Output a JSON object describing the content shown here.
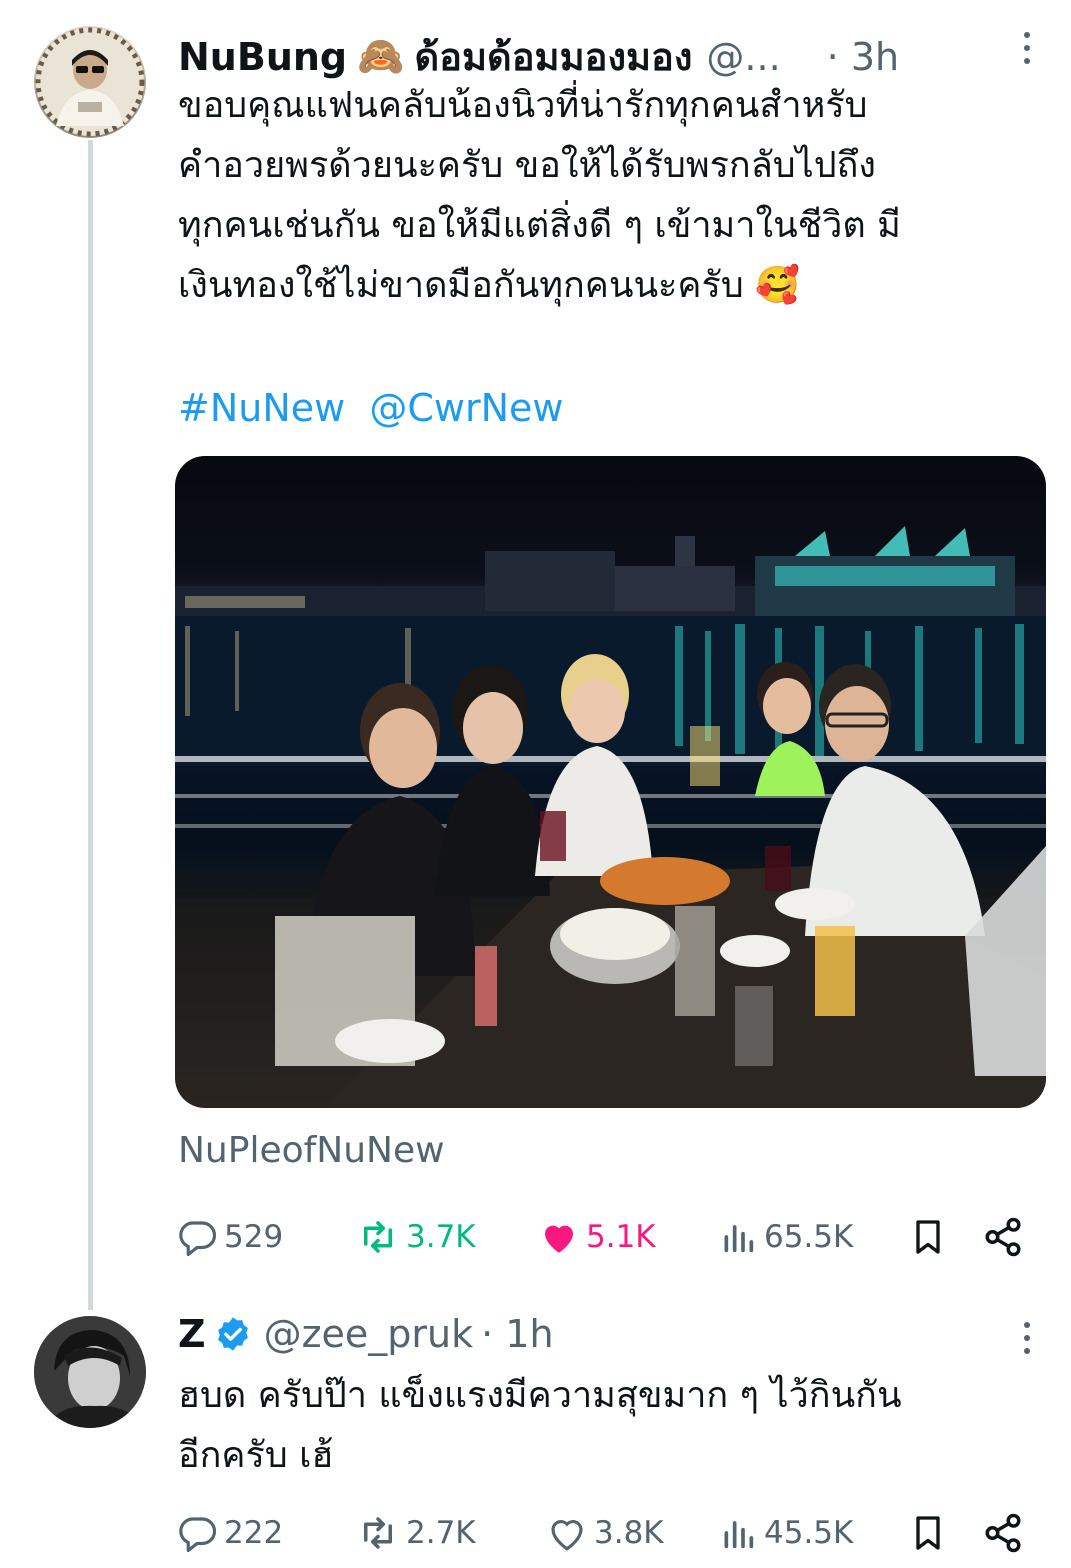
{
  "tweet1": {
    "display_name": "NuBung",
    "name_emoji": "🙈",
    "name_suffix": "ด้อมด้อมมองมอง",
    "handle": "@...",
    "time": "· 3h",
    "text_lines": [
      "ขอบคุณแฟนคลับน้องนิวที่น่ารักทุกคนสำหรับ",
      "คำอวยพรด้วยนะครับ ขอให้ได้รับพรกลับไปถึง",
      "ทุกคนเช่นกัน ขอให้มีแต่สิ่งดี ๆ เข้ามาในชีวิต มี",
      "เงินทองใช้ไม่ขาดมือกันทุกคนนะครับ 🥰"
    ],
    "hashtag": "#NuNew",
    "mention": "@CwrNew",
    "image_alt": "Group dinner by the river at night",
    "caption": "NuPleofNuNew",
    "stats": {
      "replies": "529",
      "retweets": "3.7K",
      "likes": "5.1K",
      "views": "65.5K"
    },
    "liked": true,
    "retweeted": true
  },
  "tweet2": {
    "display_name": "Z",
    "verified": true,
    "handle": "@zee_pruk",
    "time": "· 1h",
    "text_lines": [
      "ฮบด ครับป๊า แข็งแรงมีความสุขมาก ๆ ไว้กินกัน",
      "อีกครับ เฮ้"
    ],
    "stats": {
      "replies": "222",
      "retweets": "2.7K",
      "likes": "3.8K",
      "views": "45.5K"
    }
  },
  "colors": {
    "text": "#0f1419",
    "muted": "#536471",
    "link": "#1d9bf0",
    "like": "#f91880",
    "retweet": "#00ba7c",
    "thread_line": "#cfd9de"
  },
  "icons": [
    "reply-icon",
    "retweet-icon",
    "like-icon",
    "views-icon",
    "bookmark-icon",
    "share-icon",
    "more-icon",
    "verified-icon"
  ]
}
